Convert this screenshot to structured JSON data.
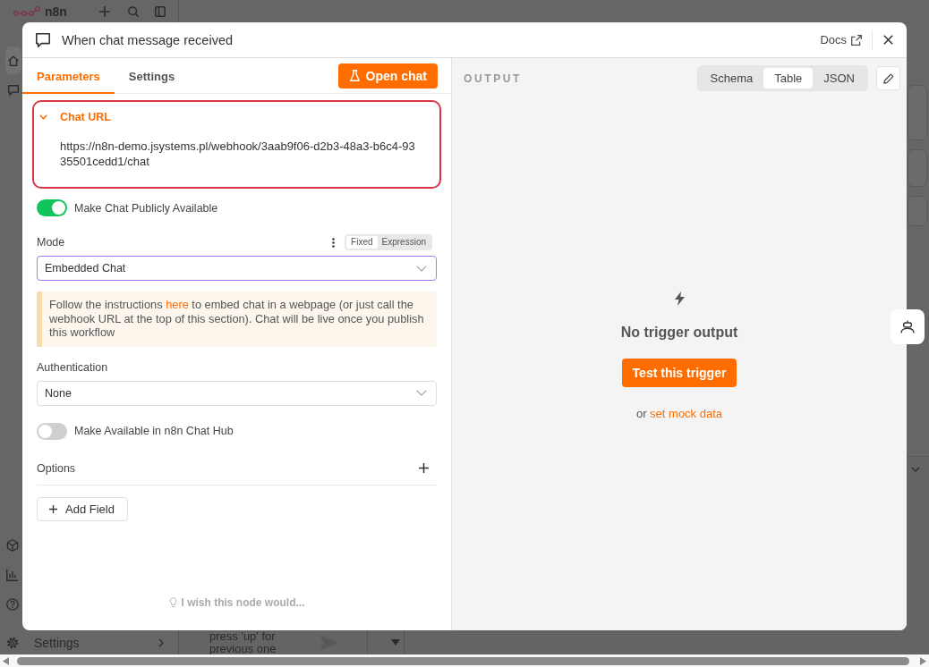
{
  "app_background": {
    "logo_text": "n8n",
    "sidebar_item": "Settings",
    "chat_input_placeholder": "press 'up' for previous one"
  },
  "node_window": {
    "title": "When chat message received",
    "docs_link": "Docs"
  },
  "tabs": [
    {
      "label": "Parameters",
      "selected": true
    },
    {
      "label": "Settings",
      "selected": false
    }
  ],
  "open_chat_button": "Open chat",
  "chat_url_section": {
    "title": "Chat URL",
    "expanded": true,
    "highlighted": true,
    "url": "https://n8n-demo.jsystems.pl/webhook/3aab9f06-d2b3-48a3-b6c4-9335501cedd1/chat"
  },
  "fields": [
    {
      "kind": "toggle",
      "label": "Make Chat Publicly Available",
      "on": true
    },
    {
      "kind": "select",
      "label": "Mode",
      "value": "Embedded Chat",
      "focused": true,
      "mode_switch": [
        {
          "label": "Fixed",
          "selected": true
        },
        {
          "label": "Expression",
          "selected": false
        }
      ]
    },
    {
      "kind": "notice",
      "text_before": "Follow the instructions",
      "link": "here",
      "text_after": "to embed chat in a webpage (or just call the webhook URL at the top of this section). Chat will be live once you publish this workflow"
    },
    {
      "kind": "select",
      "label": "Authentication",
      "value": "None",
      "focused": false
    },
    {
      "kind": "toggle",
      "label": "Make Available in n8n Chat Hub",
      "on": false
    },
    {
      "kind": "collection",
      "label": "Options"
    }
  ],
  "add_field_button": "Add Field",
  "feedback_prompt": "I wish this node would...",
  "output": {
    "title": "OUTPUT",
    "views": [
      {
        "label": "Schema",
        "selected": false
      },
      {
        "label": "Table",
        "selected": true
      },
      {
        "label": "JSON",
        "selected": false
      }
    ],
    "empty_title": "No trigger output",
    "test_button": "Test this trigger",
    "alt_prefix": "or",
    "alt_link": "set mock data"
  }
}
